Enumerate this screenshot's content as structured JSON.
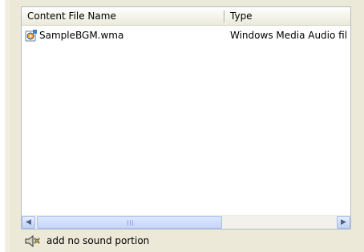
{
  "list": {
    "columns": {
      "name": "Content File Name",
      "type": "Type"
    },
    "rows": [
      {
        "name": "SampleBGM.wma",
        "type": "Windows Media Audio fil",
        "icon": "media-file-icon"
      }
    ]
  },
  "scrollbar": {
    "left_icon": "scroll-left-icon",
    "right_icon": "scroll-right-icon"
  },
  "status": {
    "label": "add no sound portion",
    "icon": "mute-speaker-icon"
  },
  "colors": {
    "window": "#ece9d8",
    "list_background": "#ffffff",
    "scrollbar_blue": "#c4d4fa"
  }
}
